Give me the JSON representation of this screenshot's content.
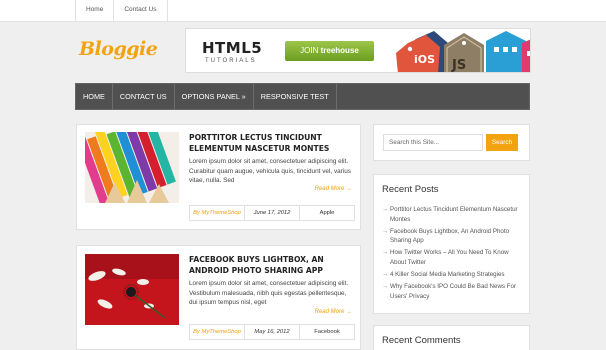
{
  "topnav": [
    "Home",
    "Contact Us"
  ],
  "logo": "Bloggie",
  "banner": {
    "title": "HTML5",
    "subtitle": "TUTORIALS",
    "button_join": "JOIN",
    "button_brand": "treehouse",
    "tag1": "iOS",
    "tag2": "JS"
  },
  "mainnav": [
    "HOME",
    "CONTACT US",
    "OPTIONS PANEL »",
    "RESPONSIVE TEST"
  ],
  "posts": [
    {
      "title": "PORTTITOR LECTUS TINCIDUNT ELEMENTUM NASCETUR MONTES",
      "excerpt": "Lorem ipsum dolor sit amet, consectetuer adipiscing elit. Curabitur quam augue, vehicula quis, tincidunt vel, varius vitae, nulla. Sed",
      "read_more": "Read More →",
      "by": "By",
      "author": "MyThemeShop",
      "date": "June 17, 2012",
      "category": "Apple"
    },
    {
      "title": "FACEBOOK BUYS LIGHTBOX, AN ANDROID PHOTO SHARING APP",
      "excerpt": "Lorem ipsum dolor sit amet, consectetuer adipiscing elit. Vestibulum malesuada, nibh quis egestas pellentesque, dui ipsum tempus nisl, eget",
      "read_more": "Read More →",
      "by": "By",
      "author": "MyThemeShop",
      "date": "May 16, 2012",
      "category": "Facebook"
    }
  ],
  "search": {
    "placeholder": "Search this Site...",
    "button": "Search"
  },
  "recent_posts": {
    "title": "Recent Posts",
    "items": [
      "Porttitor Lectus Tincidunt Elementum Nascetur Montes",
      "Facebook Buys Lightbox, An Android Photo Sharing App",
      "How Twitter Works – All You Need To Know About Twitter",
      "4 Killer Social Media Marketing Strategies",
      "Why Facebook's IPO Could Be Bad News For Users' Privacy"
    ]
  },
  "recent_comments": {
    "title": "Recent Comments"
  },
  "colors": {
    "accent": "#f3a30f",
    "nav_bg": "#505050",
    "page_bg": "#efefef"
  }
}
